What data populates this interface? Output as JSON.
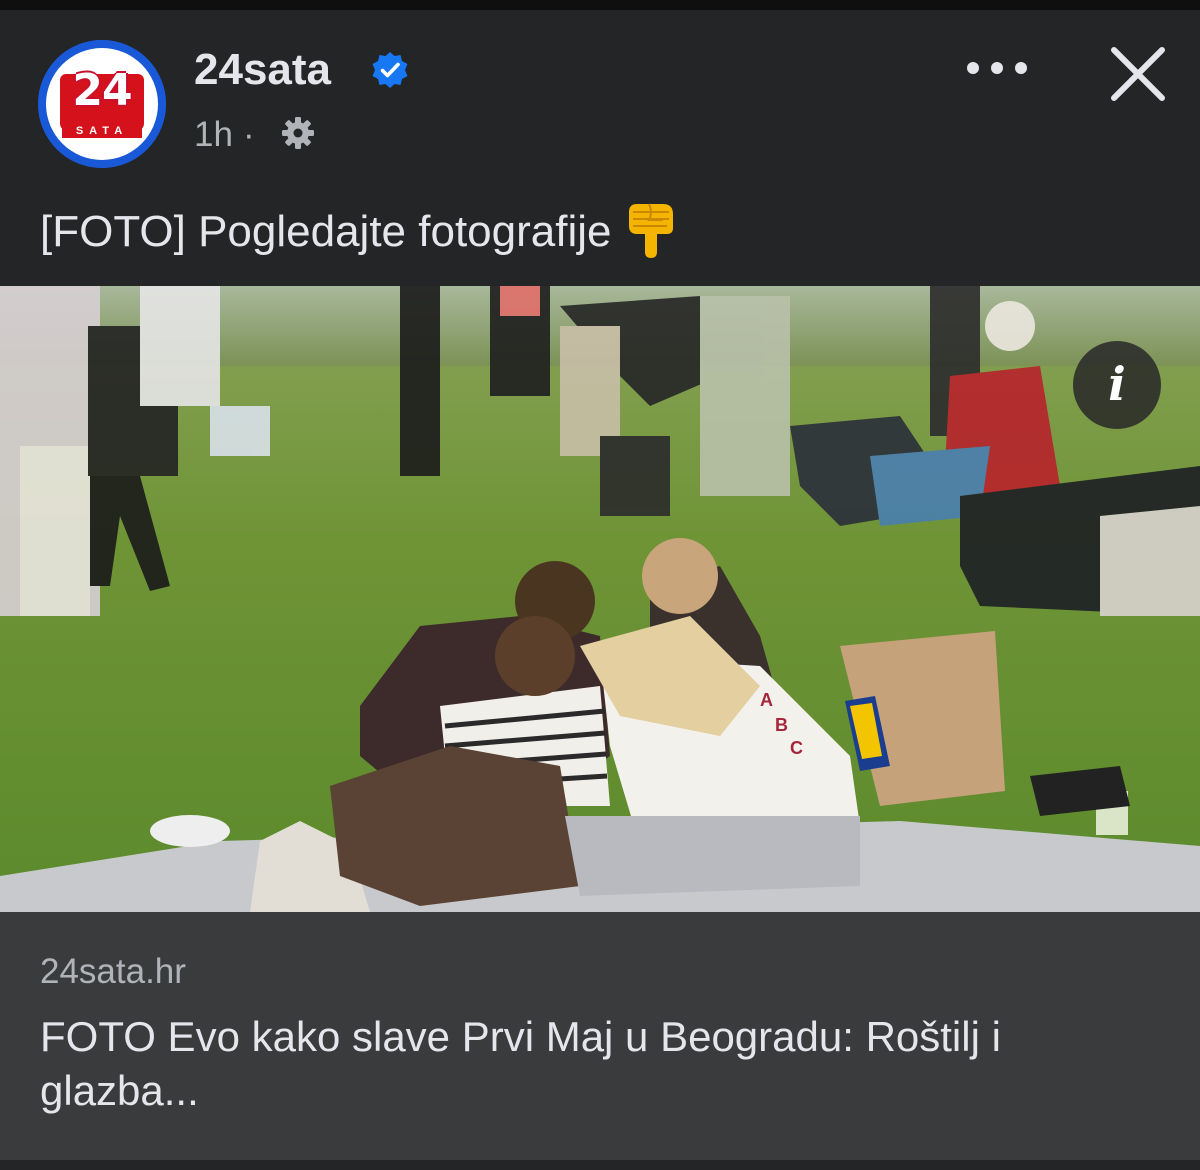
{
  "post": {
    "author": "24sata",
    "avatar": {
      "logo_main": "24",
      "logo_sub": "SATA"
    },
    "time": "1h",
    "separator": "·",
    "audience_icon": "gear-icon",
    "verified_icon": "verified-badge-icon",
    "text": "[FOTO] Pogledajte fotografije",
    "emoji": "backhand-index-pointing-down-emoji",
    "more_icon": "more-icon",
    "close_icon": "close-icon",
    "photo": {
      "info_label": "i"
    }
  },
  "link_card": {
    "domain": "24sata.hr",
    "title": "FOTO Evo kako slave Prvi Maj u Beogradu: Roštilj i glazba..."
  },
  "colors": {
    "background": "#242526",
    "text_primary": "#e4e6eb",
    "text_secondary": "#b0b3b8",
    "verified": "#1877f2",
    "link_card_bg": "#3a3b3c",
    "brand_red": "#d5121b",
    "brand_blue": "#1959d8"
  }
}
